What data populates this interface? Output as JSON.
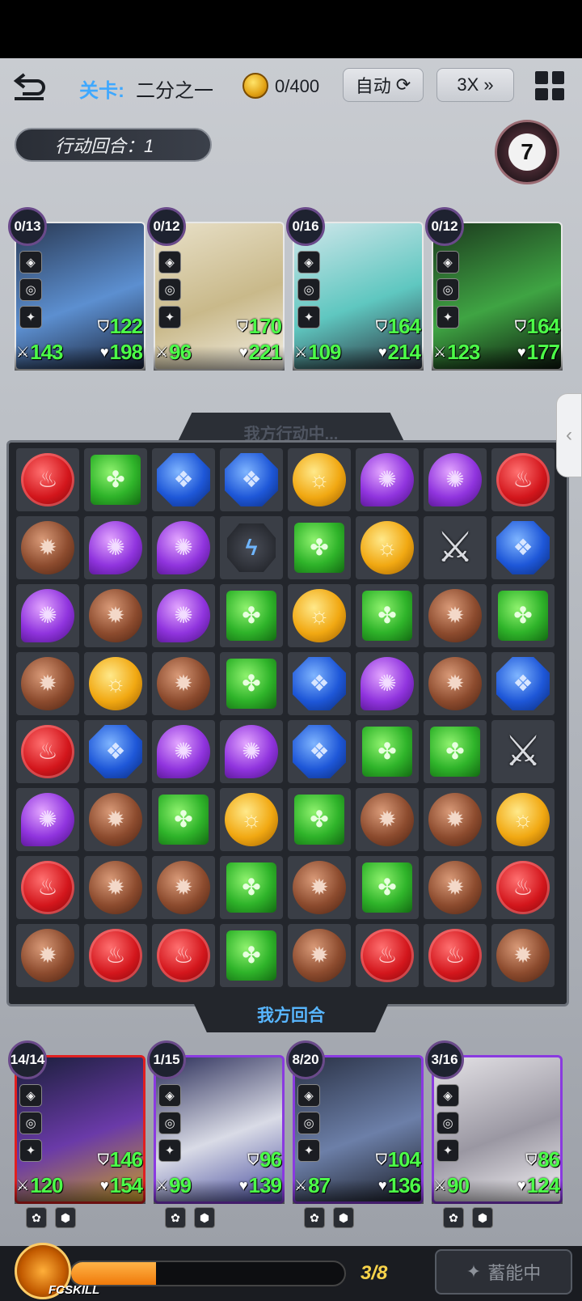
{
  "topbar": {
    "level_label": "关卡:",
    "level_name": "二分之一",
    "coins": "0/400",
    "auto_label": "自动",
    "speed_label": "3X"
  },
  "turn": {
    "label": "行动回合：1"
  },
  "enemy_eye_count": "7",
  "board": {
    "header": "我方行动中...",
    "footer": "我方回合",
    "rows": [
      [
        "red",
        "green",
        "blue",
        "blue",
        "yellow",
        "purple",
        "purple",
        "red"
      ],
      [
        "brown",
        "purple",
        "purple",
        "bolt",
        "green",
        "yellow",
        "sword",
        "blue"
      ],
      [
        "purple",
        "brown",
        "purple",
        "green",
        "yellow",
        "green",
        "brown",
        "green"
      ],
      [
        "brown",
        "yellow",
        "brown",
        "green",
        "blue",
        "purple",
        "brown",
        "blue"
      ],
      [
        "red",
        "blue",
        "purple",
        "purple",
        "blue",
        "green",
        "green",
        "sword"
      ],
      [
        "purple",
        "brown",
        "green",
        "yellow",
        "green",
        "brown",
        "brown",
        "yellow"
      ],
      [
        "red",
        "brown",
        "brown",
        "green",
        "brown",
        "green",
        "brown",
        "red"
      ],
      [
        "brown",
        "red",
        "red",
        "green",
        "brown",
        "red",
        "red",
        "brown"
      ]
    ]
  },
  "enemies": [
    {
      "count": "0/13",
      "def": "122",
      "atk": "143",
      "hp": "198",
      "colors": [
        "#2a3a55",
        "#5c8fd0",
        "#1a2236"
      ]
    },
    {
      "count": "0/12",
      "def": "170",
      "atk": "96",
      "hp": "221",
      "colors": [
        "#e8e0c8",
        "#c9b98a",
        "#f3efe4"
      ]
    },
    {
      "count": "0/16",
      "def": "164",
      "atk": "109",
      "hp": "214",
      "colors": [
        "#cfe6ea",
        "#5fc7c0",
        "#2a2e3a"
      ]
    },
    {
      "count": "0/12",
      "def": "164",
      "atk": "123",
      "hp": "177",
      "colors": [
        "#1c3a1e",
        "#3fa443",
        "#0c160d"
      ]
    }
  ],
  "allies": [
    {
      "count": "14/14",
      "def": "146",
      "atk": "120",
      "hp": "154",
      "border": "#e02020",
      "colors": [
        "#1a1f3a",
        "#6a3aa8",
        "#c59a2a"
      ]
    },
    {
      "count": "1/15",
      "def": "96",
      "atk": "99",
      "hp": "139",
      "border": "#8a3ae0",
      "colors": [
        "#2c2f5a",
        "#d9dbe6",
        "#4a4fa0"
      ]
    },
    {
      "count": "8/20",
      "def": "104",
      "atk": "87",
      "hp": "136",
      "border": "#8a3ae0",
      "colors": [
        "#2a3246",
        "#6c7fa8",
        "#1a1d26"
      ]
    },
    {
      "count": "3/16",
      "def": "86",
      "atk": "90",
      "hp": "124",
      "border": "#8a3ae0",
      "colors": [
        "#e4e2e6",
        "#9a97a2",
        "#f6f4f7"
      ]
    }
  ],
  "fc": {
    "label": "FCSKILL",
    "progress": 0.31,
    "count": "3/8",
    "charge_label": "蓄能中"
  }
}
